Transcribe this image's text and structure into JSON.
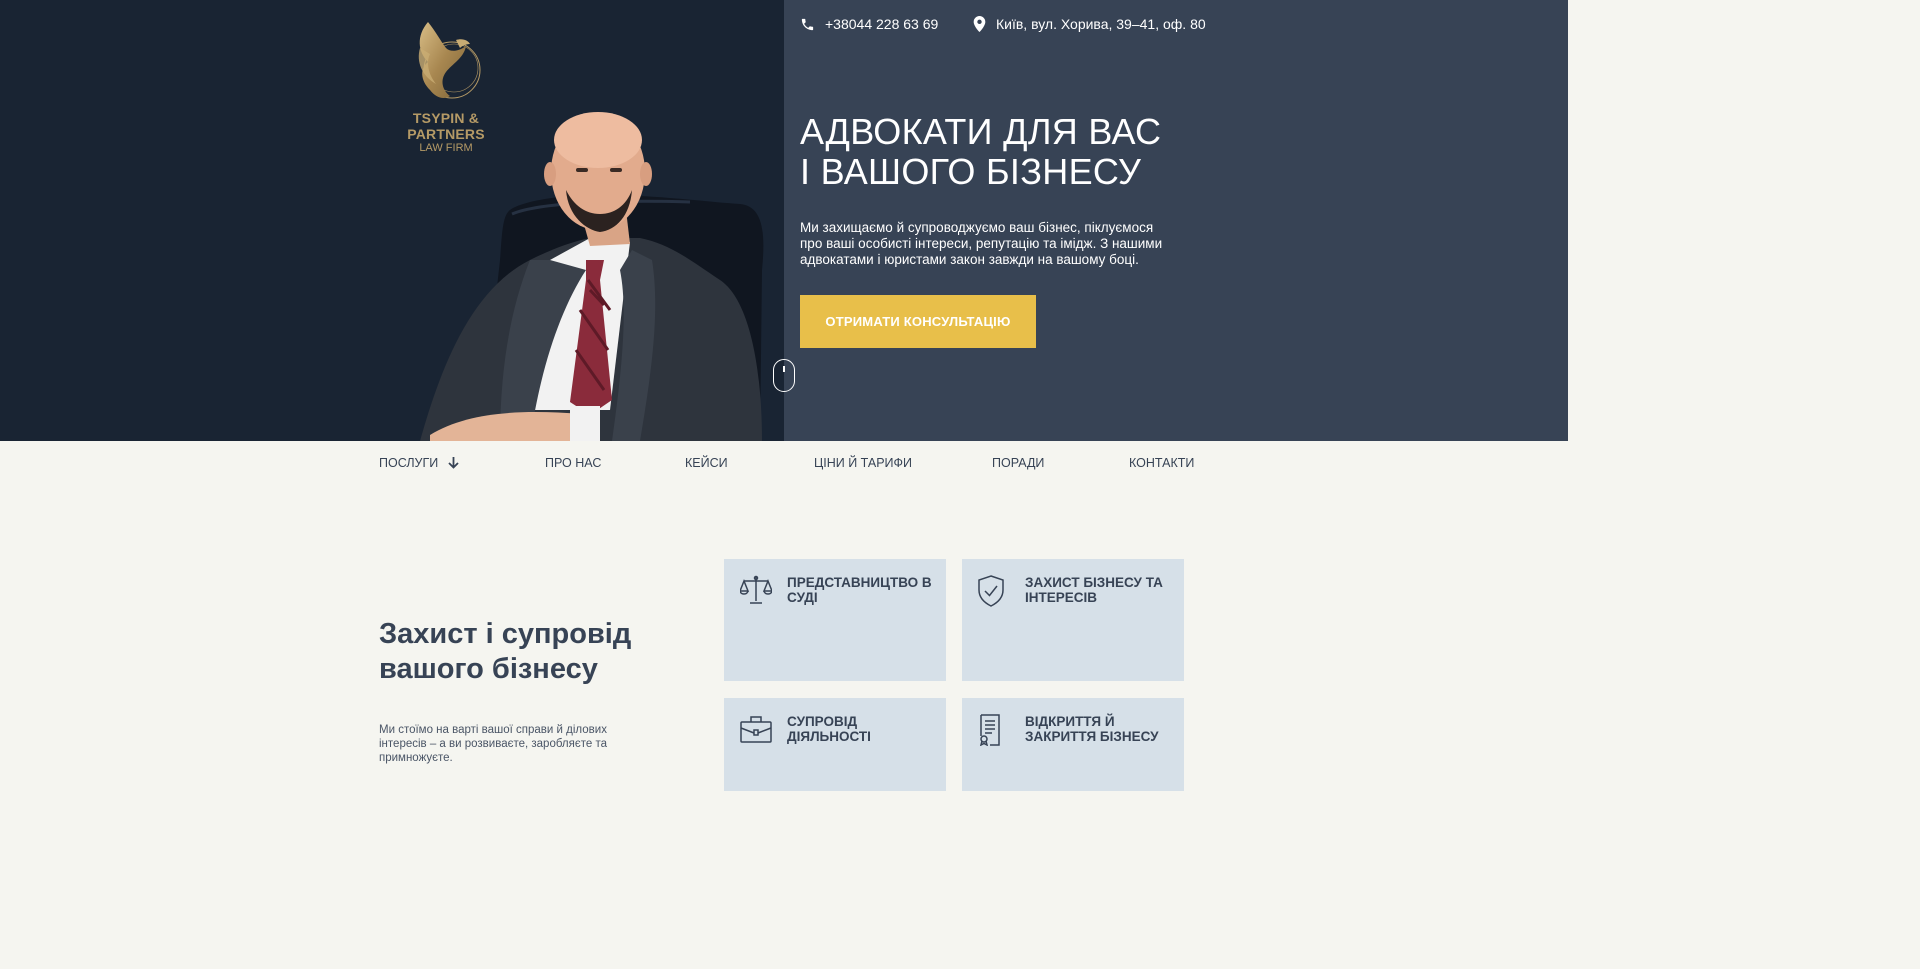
{
  "brand": {
    "name": "TSYPIN & PARTNERS",
    "subtitle": "LAW FIRM",
    "logo_icon": "phoenix-logo-icon"
  },
  "contacts": {
    "phone": "+38044 228 63 69",
    "phone_icon": "phone-icon",
    "address": "Київ, вул. Хорива, 39–41, оф. 80",
    "address_icon": "map-pin-icon"
  },
  "hero": {
    "title_line1": "АДВОКАТИ ДЛЯ ВАС",
    "title_line2": "І ВАШОГО БІЗНЕСУ",
    "description": "Ми захищаємо й супроводжуємо ваш бізнес, піклуємося про ваші особисті інтереси, репутацію та імідж. З нашими адвокатами і юристами закон завжди на вашому боці.",
    "cta_label": "ОТРИМАТИ КОНСУЛЬТАЦІЮ",
    "scroll_icon": "mouse-scroll-icon"
  },
  "nav": {
    "items": [
      {
        "label": "ПОСЛУГИ",
        "has_dropdown": true
      },
      {
        "label": "ПРО НАС"
      },
      {
        "label": "КЕЙСИ"
      },
      {
        "label": "ЦІНИ Й ТАРИФИ"
      },
      {
        "label": "ПОРАДИ"
      },
      {
        "label": "КОНТАКТИ"
      }
    ]
  },
  "section": {
    "title_line1": "Захист і супровід",
    "title_line2": "вашого бізнесу",
    "description": "Ми стоїмо на варті вашої справи й ділових інтересів – а ви розвиваєте, заробляєте та примножуєте."
  },
  "services": [
    {
      "title": "ПРЕДСТАВНИЦТВО В СУДІ",
      "icon": "scales-icon"
    },
    {
      "title": "ЗАХИСТ БІЗНЕСУ ТА ІНТЕРЕСІВ",
      "icon": "shield-check-icon"
    },
    {
      "title": "СУПРОВІД ДІЯЛЬНОСТІ",
      "icon": "briefcase-icon"
    },
    {
      "title": "ВІДКРИТТЯ Й ЗАКРИТТЯ БІЗНЕСУ",
      "icon": "certificate-document-icon"
    }
  ],
  "colors": {
    "hero_left_bg": "#192433",
    "hero_right_bg": "#374355",
    "accent": "#e8bf4a",
    "gold": "#b59a66",
    "page_bg": "#f5f5f0",
    "card_bg": "#d6e0e8",
    "text_dark": "#374355"
  }
}
